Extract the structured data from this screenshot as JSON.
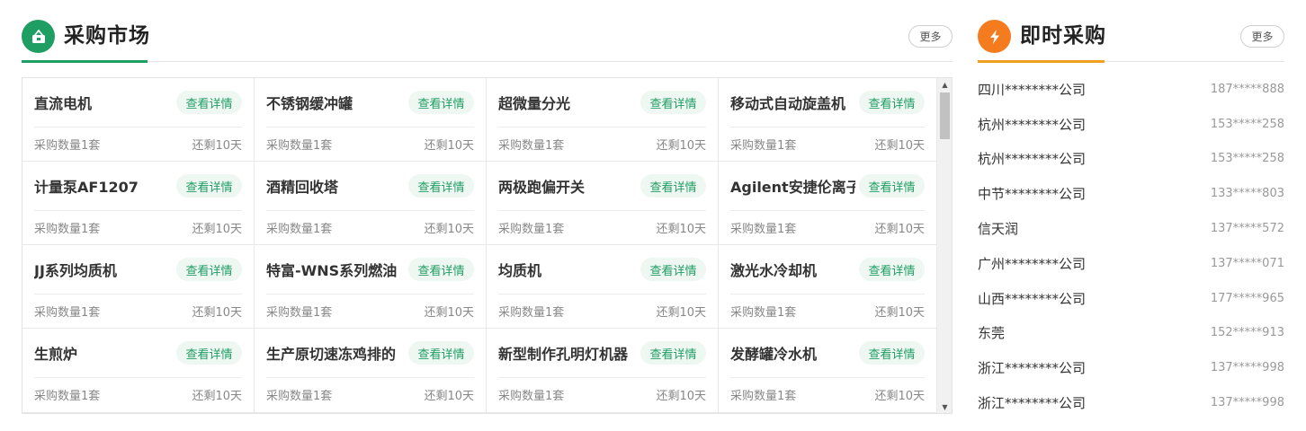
{
  "market": {
    "title": "采购市场",
    "more_label": "更多",
    "detail_label": "查看详情",
    "qty_label": "采购数量1套",
    "days_label": "还剩10天",
    "colors": {
      "accent": "#1f9e63",
      "badge_bg": "#eef7f2"
    },
    "icon": "shopping-basket-icon",
    "items": [
      {
        "name": "直流电机"
      },
      {
        "name": "不锈钢缓冲罐"
      },
      {
        "name": "超微量分光"
      },
      {
        "name": "移动式自动旋盖机"
      },
      {
        "name": "计量泵AF1207"
      },
      {
        "name": "酒精回收塔"
      },
      {
        "name": "两极跑偏开关"
      },
      {
        "name": "Agilent安捷伦离子泵"
      },
      {
        "name": "JJ系列均质机"
      },
      {
        "name": "特富-WNS系列燃油"
      },
      {
        "name": "均质机"
      },
      {
        "name": "激光水冷却机"
      },
      {
        "name": "生煎炉"
      },
      {
        "name": "生产原切速冻鸡排的"
      },
      {
        "name": "新型制作孔明灯机器"
      },
      {
        "name": "发酵罐冷水机"
      }
    ]
  },
  "instant": {
    "title": "即时采购",
    "more_label": "更多",
    "colors": {
      "accent": "#f47b1e"
    },
    "icon": "lightning-icon",
    "rows": [
      {
        "company": "四川********公司",
        "phone": "187*****888"
      },
      {
        "company": "杭州********公司",
        "phone": "153*****258"
      },
      {
        "company": "杭州********公司",
        "phone": "153*****258"
      },
      {
        "company": "中节********公司",
        "phone": "133*****803"
      },
      {
        "company": "信天润",
        "phone": "137*****572"
      },
      {
        "company": "广州********公司",
        "phone": "137*****071"
      },
      {
        "company": "山西********公司",
        "phone": "177*****965"
      },
      {
        "company": "东莞",
        "phone": "152*****913"
      },
      {
        "company": "浙江********公司",
        "phone": "137*****998"
      },
      {
        "company": "浙江********公司",
        "phone": "137*****998"
      }
    ]
  }
}
